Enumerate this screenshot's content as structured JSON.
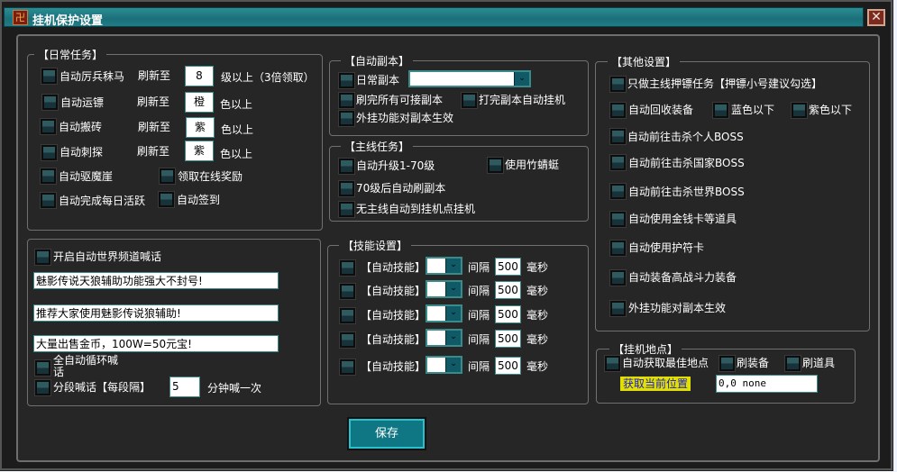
{
  "window": {
    "title": "挂机保护设置",
    "close_label": "✕",
    "icon": "game-app-icon"
  },
  "daily": {
    "title": "【日常任务】",
    "rows": [
      {
        "label": "自动厉兵秣马",
        "refresh": "刷新至",
        "value": "8",
        "suffix": "级以上（3倍领取）"
      },
      {
        "label": "自动运镖",
        "refresh": "刷新至",
        "value": "橙",
        "suffix": "色以上"
      },
      {
        "label": "自动搬砖",
        "refresh": "刷新至",
        "value": "紫",
        "suffix": "色以上"
      },
      {
        "label": "自动刺探",
        "refresh": "刷新至",
        "value": "紫",
        "suffix": "色以上"
      }
    ],
    "extra": [
      "自动驱魔崖",
      "领取在线奖励",
      "自动完成每日活跃",
      "自动签到"
    ]
  },
  "chat": {
    "enable": "开启自动世界频道喊话",
    "messages": [
      "魅影传说天狼辅助功能强大不封号!",
      "推荐大家使用魅影传说狼辅助!",
      "大量出售金币，100W=50元宝!"
    ],
    "loop": "全自动循环喊话",
    "segment": "分段喊话【每段隔】",
    "interval": "5",
    "interval_suffix": "分钟喊一次"
  },
  "dungeon": {
    "title": "【自动副本】",
    "daily": "日常副本",
    "daily_select": "",
    "all": "刷完所有可接副本",
    "after": "打完副本自动挂机",
    "effect": "外挂功能对副本生效"
  },
  "main": {
    "title": "【主线任务】",
    "items": [
      "自动升级1-70级",
      "使用竹蜻蜓",
      "70级后自动刷副本",
      "无主线自动到挂机点挂机"
    ]
  },
  "skills": {
    "title": "【技能设置】",
    "label": "【自动技能】",
    "interval_label": "间隔",
    "unit": "毫秒",
    "values": [
      "500",
      "500",
      "500",
      "500",
      "500"
    ]
  },
  "other": {
    "title": "【其他设置】",
    "items": [
      "只做主线押镖任务【押镖小号建议勾选】",
      "自动回收装备",
      "蓝色以下",
      "紫色以下",
      "自动前往击杀个人BOSS",
      "自动前往击杀国家BOSS",
      "自动前往击杀世界BOSS",
      "自动使用金钱卡等道具",
      "自动使用护符卡",
      "自动装备高战斗力装备",
      "外挂功能对副本生效"
    ]
  },
  "spot": {
    "title": "【挂机地点】",
    "best": "自动获取最佳地点",
    "equip": "刷装备",
    "items": "刷道具",
    "get_pos": "获取当前位置",
    "pos": "0,0 none"
  },
  "save_label": "保存",
  "colors": {
    "title_bar": "#1f7d86",
    "panel": "#262626",
    "button": "#0f7783",
    "highlight": "#e1e000"
  }
}
